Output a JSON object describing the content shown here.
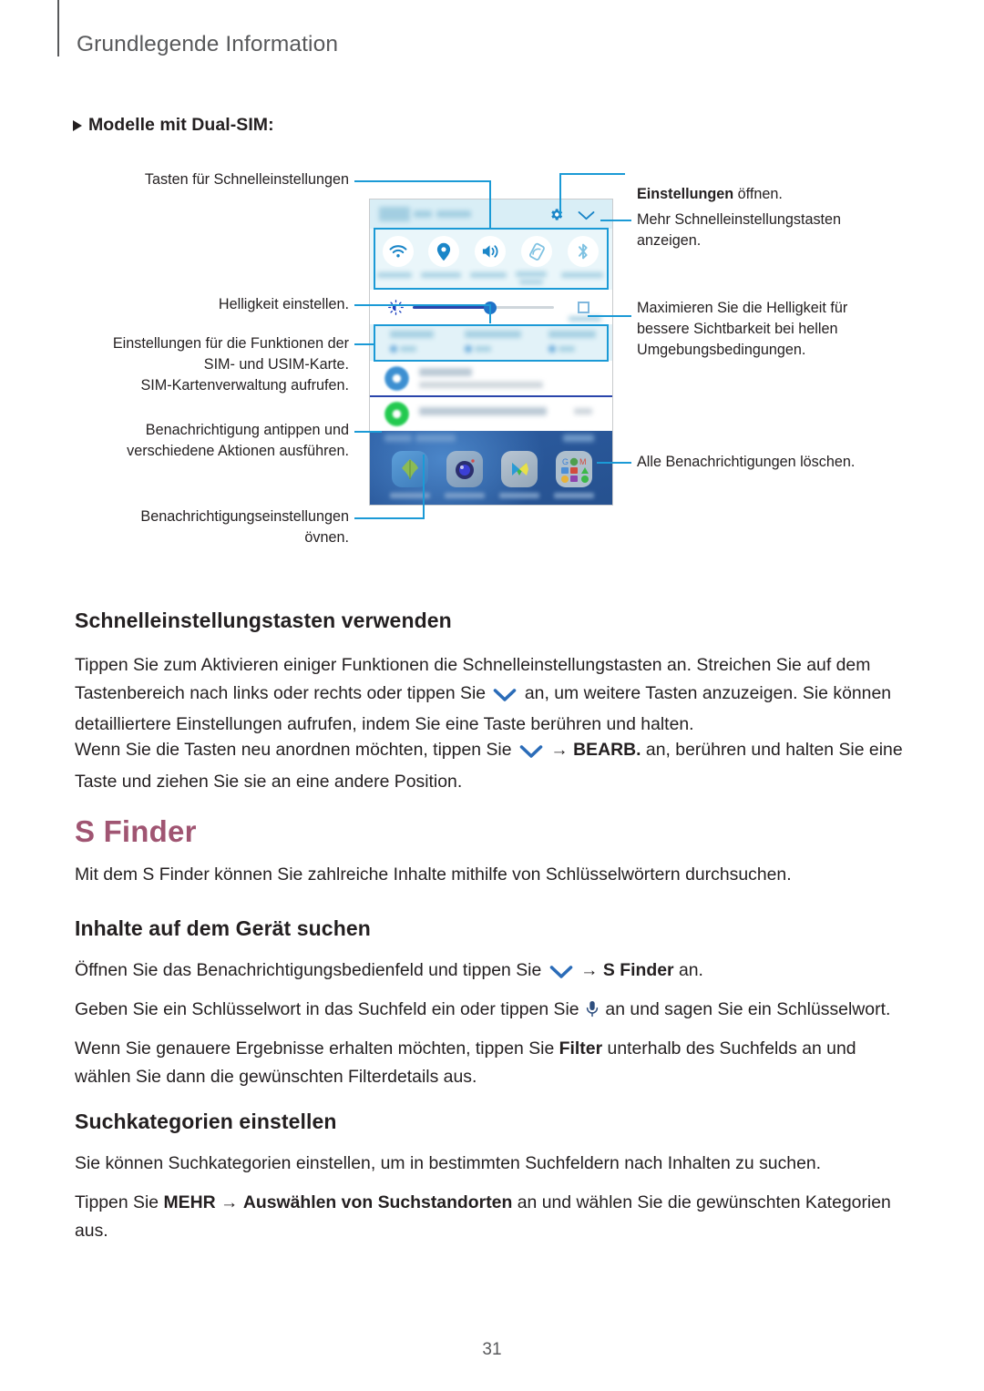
{
  "header": {
    "title": "Grundlegende Information"
  },
  "section_note": {
    "marker": "triangle-bullet",
    "text": "Modelle mit Dual-SIM:"
  },
  "figure": {
    "callouts": [
      {
        "id": "quick-setting-buttons",
        "text": "Tasten für Schnelleinstellungen",
        "align": "right"
      },
      {
        "id": "adjust-brightness",
        "text": "Helligkeit einstellen.",
        "align": "right"
      },
      {
        "id": "sim-usim-settings",
        "text": "Einstellungen für die Funktionen der\nSIM- und USIM-Karte.\nSIM-Kartenverwaltung aufrufen.",
        "align": "right"
      },
      {
        "id": "tap-notification",
        "text": "Benachrichtigung antippen und\nverschiedene Aktionen ausführen.",
        "align": "right"
      },
      {
        "id": "notification-settings",
        "text": "Benachrichtigungseinstellungen\növnen.",
        "align": "right"
      },
      {
        "id": "open-settings",
        "text_bold": "Einstellungen",
        "text_rest": " öffnen.",
        "align": "left"
      },
      {
        "id": "show-more-buttons",
        "text": "Mehr Schnelleinstellungstasten\nanzeigen.",
        "align": "left"
      },
      {
        "id": "maximize-brightness",
        "text": "Maximieren Sie die Helligkeit für\nbessere Sichtbarkeit bei hellen\nUmgebungsbedingungen.",
        "align": "left"
      },
      {
        "id": "clear-all-notifications",
        "text": "Alle Benachrichtigungen löschen.",
        "align": "left"
      }
    ],
    "callout_fix": {
      "notification_settings": "Benachrichtigungseinstellungen\növnen."
    },
    "phone": {
      "quick_tiles": [
        {
          "icon": "wifi-icon",
          "active": true
        },
        {
          "icon": "location-icon",
          "active": true
        },
        {
          "icon": "sound-icon",
          "active": true
        },
        {
          "icon": "rotate-icon",
          "active": false
        },
        {
          "icon": "bluetooth-icon",
          "active": false
        }
      ],
      "brightness": {
        "icon": "brightness-icon",
        "value_percent": 55,
        "auto_checkbox": false
      },
      "settings_icon": "gear-icon",
      "expand_icon": "chevron-down-icon",
      "notifications": [
        {
          "icon": "profile-sharing-icon"
        },
        {
          "icon": "network-icon"
        }
      ],
      "dock_apps": [
        {
          "icon": "gallery-icon"
        },
        {
          "icon": "camera-icon"
        },
        {
          "icon": "play-store-icon"
        },
        {
          "icon": "google-folder-icon"
        }
      ]
    }
  },
  "body": {
    "h2_quick_settings": "Schnelleinstellungstasten verwenden",
    "p1_a": "Tippen Sie zum Aktivieren einiger Funktionen die Schnelleinstellungstasten an. Streichen Sie auf dem Tastenbereich nach links oder rechts oder tippen Sie ",
    "p1_b": " an, um weitere Tasten anzuzeigen. Sie können detailliertere Einstellungen aufrufen, indem Sie eine Taste berühren und halten.",
    "p2_a": "Wenn Sie die Tasten neu anordnen möchten, tippen Sie ",
    "p2_arrow": " → ",
    "p2_bold": "BEARB.",
    "p2_b": " an, berühren und halten Sie eine Taste und ziehen Sie sie an eine andere Position.",
    "h1_s_finder": "S Finder",
    "p3": "Mit dem S Finder können Sie zahlreiche Inhalte mithilfe von Schlüsselwörtern durchsuchen.",
    "h2_search_device": "Inhalte auf dem Gerät suchen",
    "p4_a": "Öffnen Sie das Benachrichtigungsbedienfeld und tippen Sie ",
    "p4_arrow": " → ",
    "p4_bold": "S Finder",
    "p4_b": " an.",
    "p5_a": "Geben Sie ein Schlüsselwort in das Suchfeld ein oder tippen Sie ",
    "p5_b": " an und sagen Sie ein Schlüsselwort.",
    "p6_a": "Wenn Sie genauere Ergebnisse erhalten möchten, tippen Sie ",
    "p6_bold": "Filter",
    "p6_b": " unterhalb des Suchfelds an und wählen Sie dann die gewünschten Filterdetails aus.",
    "h2_search_categories": "Suchkategorien einstellen",
    "p7": "Sie können Suchkategorien einstellen, um in bestimmten Suchfeldern nach Inhalten zu suchen.",
    "p8_a": "Tippen Sie ",
    "p8_bold1": "MEHR",
    "p8_arrow": " → ",
    "p8_bold2": "Auswählen von Suchstandorten",
    "p8_b": " an und wählen Sie die gewünschten Kategorien aus."
  },
  "footer": {
    "page_number": "31"
  },
  "colors": {
    "accent_blue": "#1b9ad6",
    "heading_maroon": "#a05572",
    "chevron_blue": "#2b6cb8",
    "header_grey": "#58595b",
    "text_black": "#231f20"
  }
}
